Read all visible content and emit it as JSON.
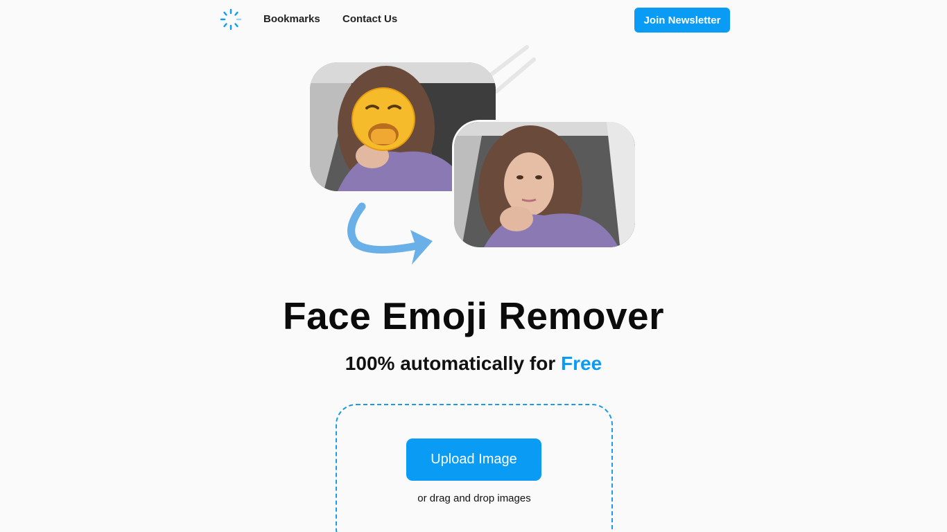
{
  "header": {
    "logo_icon": "spinner-logo-icon",
    "nav": [
      {
        "label": "Bookmarks"
      },
      {
        "label": "Contact Us"
      }
    ],
    "cta_label": "Join Newsletter"
  },
  "hero": {
    "before_image": "girl-photo-with-yawning-emoji",
    "after_image": "girl-photo-without-emoji",
    "arrow_icon": "curved-arrow-icon"
  },
  "main": {
    "title": "Face Emoji Remover",
    "subtitle_prefix": "100% automatically for ",
    "subtitle_highlight": "Free",
    "upload_label": "Upload Image",
    "drop_hint": "or drag and drop images"
  },
  "colors": {
    "accent": "#0a9bf5",
    "dash_border": "#1a9be6",
    "background": "#fafafa"
  }
}
